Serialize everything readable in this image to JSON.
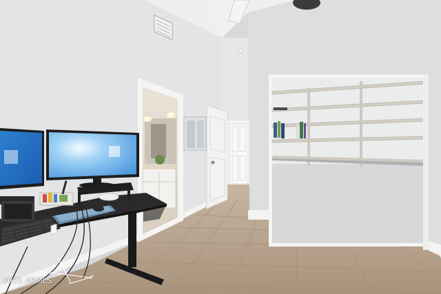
{
  "photo": {
    "watermark": "2025 ARMLS",
    "palette": {
      "wall_left": "#e3e4e6",
      "wall_right": "#dcdee0",
      "ceiling": "#eeeff0",
      "floor": "#b9a690",
      "floor_dark": "#a18e78",
      "door": "#f2f2f0",
      "shelf": "#d3cfc6",
      "desk_top": "#2a2a2c",
      "desk_frame": "#1a1a1b",
      "monitor_screen": "#5aa8e6"
    },
    "objects": [
      "ceiling-fan",
      "air-vent",
      "bathroom-doorway",
      "open-door",
      "hallway-door",
      "closet-with-shelves",
      "standing-desk",
      "monitor-left",
      "monitor-right",
      "keyboard",
      "mouse",
      "desk-accessories",
      "cables"
    ]
  }
}
